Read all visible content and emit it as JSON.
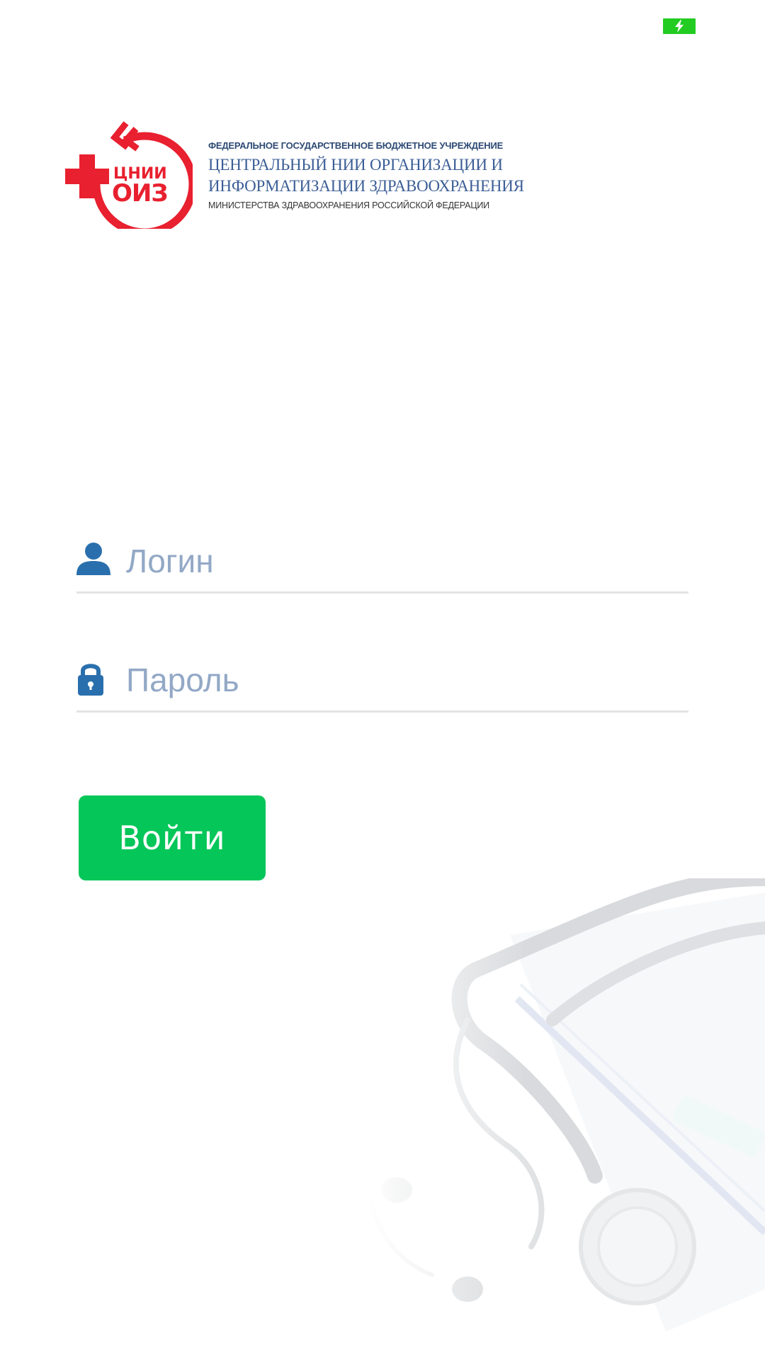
{
  "status_bar": {
    "battery_icon": "battery-charging-icon",
    "battery_color": "#22cc22"
  },
  "logo": {
    "mark_text_top": "ЦНИИ",
    "mark_text_bottom": "ОИЗ",
    "line1": "ФЕДЕРАЛЬНОЕ ГОСУДАРСТВЕННОЕ БЮДЖЕТНОЕ УЧРЕЖДЕНИЕ",
    "line2": "ЦЕНТРАЛЬНЫЙ НИИ ОРГАНИЗАЦИИ И",
    "line3": "ИНФОРМАТИЗАЦИИ ЗДРАВООХРАНЕНИЯ",
    "line4": "МИНИСТЕРСТВА ЗДРАВООХРАНЕНИЯ РОССИЙСКОЙ ФЕДЕРАЦИИ",
    "brand_red": "#e8202f",
    "brand_blue": "#3b5e96"
  },
  "form": {
    "login": {
      "icon": "user-icon",
      "placeholder": "Логин",
      "value": ""
    },
    "password": {
      "icon": "lock-icon",
      "placeholder": "Пароль",
      "value": ""
    },
    "submit_label": "Войти",
    "accent_color": "#05c659",
    "icon_color": "#2a6fad"
  },
  "background": {
    "illustration": "stethoscope-illustration"
  }
}
